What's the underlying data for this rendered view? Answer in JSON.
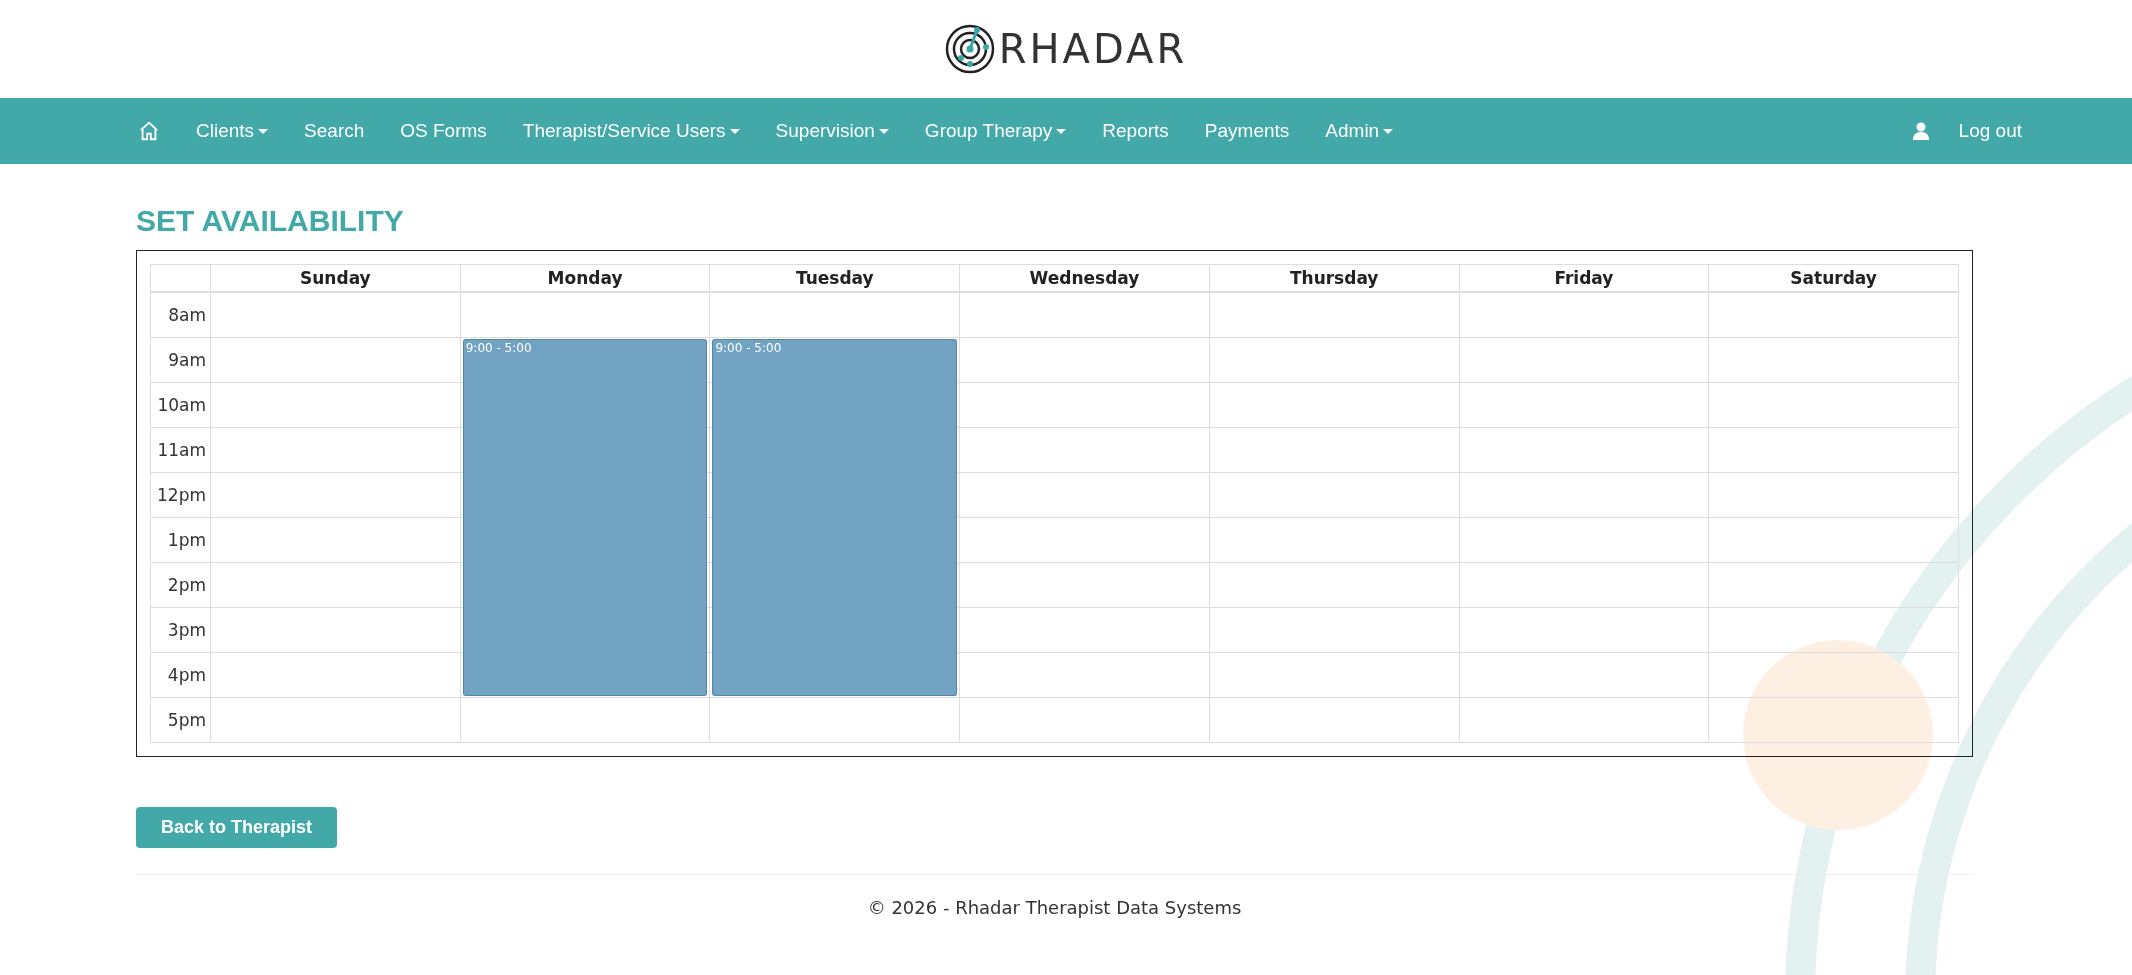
{
  "logo": {
    "text": "RHADAR"
  },
  "nav": {
    "items": [
      {
        "label": "Clients",
        "dropdown": true
      },
      {
        "label": "Search",
        "dropdown": false
      },
      {
        "label": "OS Forms",
        "dropdown": false
      },
      {
        "label": "Therapist/Service Users",
        "dropdown": true
      },
      {
        "label": "Supervision",
        "dropdown": true
      },
      {
        "label": "Group Therapy",
        "dropdown": true
      },
      {
        "label": "Reports",
        "dropdown": false
      },
      {
        "label": "Payments",
        "dropdown": false
      },
      {
        "label": "Admin",
        "dropdown": true
      }
    ],
    "logout": "Log out"
  },
  "title": "SET AVAILABILITY",
  "calendar": {
    "days": [
      {
        "name": "Sunday"
      },
      {
        "name": "Monday",
        "event": "9:00 - 5:00"
      },
      {
        "name": "Tuesday",
        "event": "9:00 - 5:00"
      },
      {
        "name": "Wednesday"
      },
      {
        "name": "Thursday"
      },
      {
        "name": "Friday"
      },
      {
        "name": "Saturday"
      }
    ],
    "hours": [
      {
        "label": "8am",
        "available": [
          false,
          false,
          false,
          false,
          false,
          false,
          false
        ]
      },
      {
        "label": "9am",
        "available": [
          false,
          true,
          true,
          false,
          false,
          false,
          false
        ]
      },
      {
        "label": "10am",
        "available": [
          false,
          true,
          true,
          false,
          false,
          false,
          false
        ]
      },
      {
        "label": "11am",
        "available": [
          false,
          true,
          true,
          false,
          false,
          false,
          false
        ]
      },
      {
        "label": "12pm",
        "available": [
          false,
          true,
          true,
          false,
          false,
          false,
          false
        ]
      },
      {
        "label": "1pm",
        "available": [
          false,
          true,
          true,
          false,
          false,
          false,
          false
        ]
      },
      {
        "label": "2pm",
        "available": [
          false,
          true,
          true,
          false,
          false,
          false,
          false
        ]
      },
      {
        "label": "3pm",
        "available": [
          false,
          true,
          true,
          false,
          false,
          false,
          false
        ]
      },
      {
        "label": "4pm",
        "available": [
          false,
          true,
          true,
          false,
          false,
          false,
          false
        ]
      },
      {
        "label": "5pm",
        "available": [
          false,
          false,
          false,
          false,
          false,
          false,
          false
        ]
      }
    ]
  },
  "back_button": "Back to Therapist",
  "footer": "© 2026 - Rhadar Therapist Data Systems"
}
